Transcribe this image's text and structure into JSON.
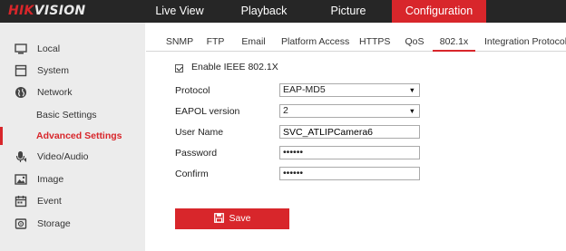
{
  "brand": {
    "part1": "HIK",
    "part2": "VISION"
  },
  "topnav": [
    {
      "label": "Live View",
      "active": false
    },
    {
      "label": "Playback",
      "active": false
    },
    {
      "label": "Picture",
      "active": false
    },
    {
      "label": "Configuration",
      "active": true
    }
  ],
  "sidebar": {
    "items": [
      {
        "label": "Local",
        "icon": "monitor-icon"
      },
      {
        "label": "System",
        "icon": "system-icon"
      },
      {
        "label": "Network",
        "icon": "globe-icon"
      },
      {
        "label": "Basic Settings"
      },
      {
        "label": "Advanced Settings",
        "active": true
      },
      {
        "label": "Video/Audio",
        "icon": "video-audio-icon"
      },
      {
        "label": "Image",
        "icon": "image-icon"
      },
      {
        "label": "Event",
        "icon": "calendar-icon"
      },
      {
        "label": "Storage",
        "icon": "storage-icon"
      }
    ]
  },
  "tabs": [
    {
      "label": "SNMP"
    },
    {
      "label": "FTP"
    },
    {
      "label": "Email"
    },
    {
      "label": "Platform Access"
    },
    {
      "label": "HTTPS"
    },
    {
      "label": "QoS"
    },
    {
      "label": "802.1x",
      "active": true
    },
    {
      "label": "Integration Protocol"
    }
  ],
  "form": {
    "enable_label": "Enable IEEE 802.1X",
    "enable_checked": true,
    "protocol_label": "Protocol",
    "protocol_value": "EAP-MD5",
    "eapol_label": "EAPOL version",
    "eapol_value": "2",
    "username_label": "User Name",
    "username_value": "SVC_ATLIPCamera6",
    "password_label": "Password",
    "password_value": "••••••",
    "confirm_label": "Confirm",
    "confirm_value": "••••••"
  },
  "save_label": "Save",
  "colors": {
    "accent": "#d8262b",
    "topbar": "#262626",
    "sidebar": "#ececec"
  }
}
